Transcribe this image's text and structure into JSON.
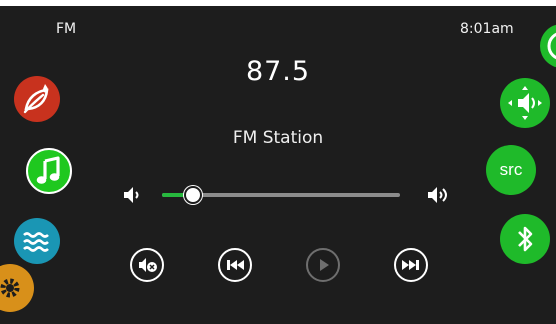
{
  "header": {
    "source": "FM",
    "time": "8:01am"
  },
  "tuner": {
    "frequency": "87.5",
    "station_name": "FM Station"
  },
  "volume": {
    "level": 0.13
  },
  "left_menu": [
    {
      "name": "heat-leaf-icon",
      "color": "#c8321e"
    },
    {
      "name": "music-note-icon",
      "color": "#1fc81f",
      "active": true
    },
    {
      "name": "water-waves-icon",
      "color": "#1a96b4"
    },
    {
      "name": "settings-gear-icon",
      "color": "#d8901a"
    }
  ],
  "right_menu": [
    {
      "name": "speaker-select-icon",
      "color": "#1fba2a"
    },
    {
      "name": "source-button",
      "label": "src",
      "color": "#1fba2a"
    },
    {
      "name": "bluetooth-icon",
      "color": "#1fba2a"
    }
  ],
  "transport": [
    {
      "name": "mute-icon",
      "enabled": true
    },
    {
      "name": "previous-icon",
      "enabled": true
    },
    {
      "name": "play-icon",
      "enabled": false
    },
    {
      "name": "next-icon",
      "enabled": true
    }
  ],
  "colors": {
    "background": "#1d1d1d",
    "accent_green": "#1fba2a",
    "slider_fill": "#27b83e",
    "slider_track": "#8c8c8c"
  }
}
